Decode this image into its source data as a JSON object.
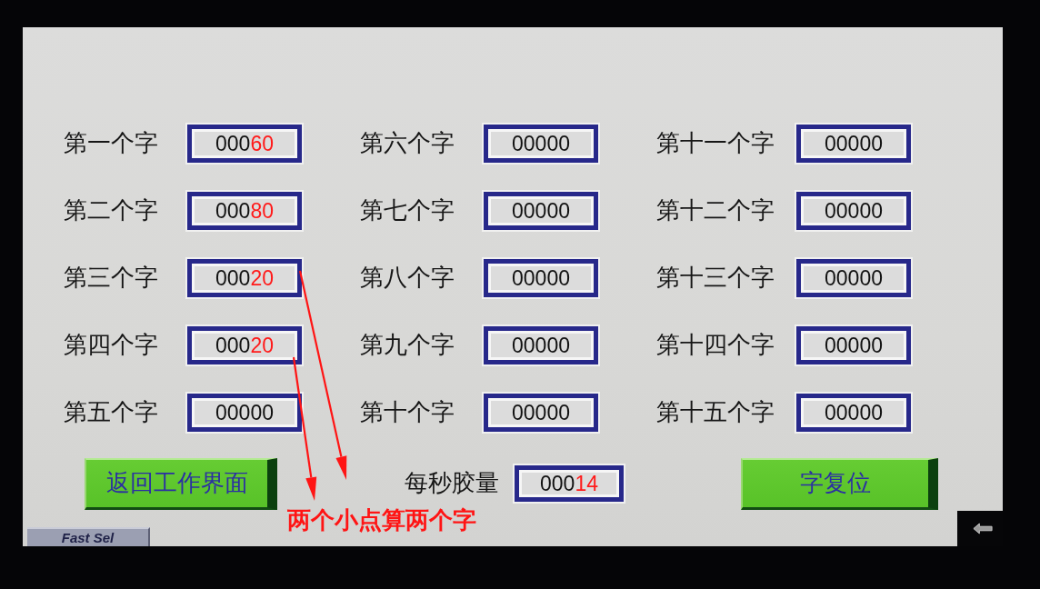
{
  "fields": [
    {
      "label": "第一个字",
      "value": "000",
      "value_highlight": "60"
    },
    {
      "label": "第二个字",
      "value": "000",
      "value_highlight": "80"
    },
    {
      "label": "第三个字",
      "value": "000",
      "value_highlight": "20"
    },
    {
      "label": "第四个字",
      "value": "000",
      "value_highlight": "20"
    },
    {
      "label": "第五个字",
      "value": "00000"
    },
    {
      "label": "第六个字",
      "value": "00000"
    },
    {
      "label": "第七个字",
      "value": "00000"
    },
    {
      "label": "第八个字",
      "value": "00000"
    },
    {
      "label": "第九个字",
      "value": "00000"
    },
    {
      "label": "第十个字",
      "value": "00000"
    },
    {
      "label": "第十一个字",
      "value": "00000"
    },
    {
      "label": "第十二个字",
      "value": "00000"
    },
    {
      "label": "第十三个字",
      "value": "00000"
    },
    {
      "label": "第十四个字",
      "value": "00000"
    },
    {
      "label": "第十五个字",
      "value": "00000"
    }
  ],
  "return_button": {
    "label": "返回工作界面"
  },
  "glue_rate": {
    "label": "每秒胶量",
    "value": "000",
    "value_highlight": "14"
  },
  "reset_button": {
    "label": "字复位"
  },
  "tab": {
    "label": "Fast Sel"
  },
  "annotation": {
    "text": "两个小点算两个字"
  }
}
